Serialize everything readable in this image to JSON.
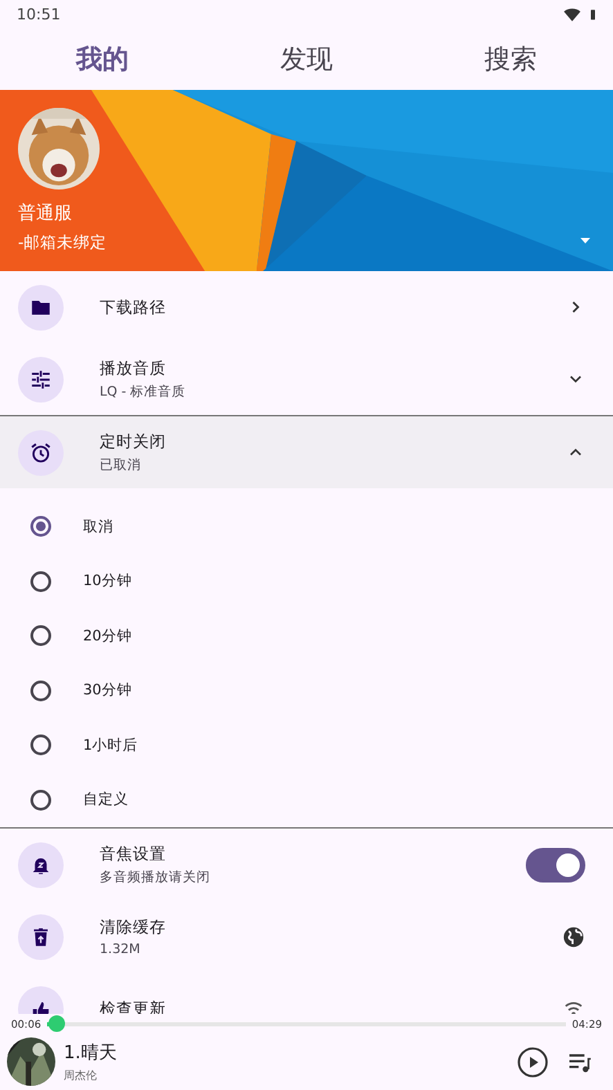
{
  "status_bar": {
    "time": "10:51"
  },
  "tabs": [
    {
      "label": "我的",
      "selected": true
    },
    {
      "label": "发现",
      "selected": false
    },
    {
      "label": "搜索",
      "selected": false
    }
  ],
  "profile": {
    "name": "普通服",
    "email": "-邮箱未绑定"
  },
  "settings": [
    {
      "kind": "link",
      "title": "下载路径"
    },
    {
      "kind": "expand",
      "title": "播放音质",
      "subtitle": "LQ - 标准音质",
      "expanded": false
    },
    {
      "kind": "expand",
      "title": "定时关闭",
      "subtitle": "已取消",
      "expanded": true,
      "options": [
        {
          "label": "取消",
          "selected": true
        },
        {
          "label": "10分钟",
          "selected": false
        },
        {
          "label": "20分钟",
          "selected": false
        },
        {
          "label": "30分钟",
          "selected": false
        },
        {
          "label": "1小时后",
          "selected": false
        },
        {
          "label": "自定义",
          "selected": false
        }
      ]
    },
    {
      "kind": "switch",
      "title": "音焦设置",
      "subtitle": "多音频播放请关闭",
      "on": true
    },
    {
      "kind": "action",
      "title": "清除缓存",
      "subtitle": "1.32M"
    },
    {
      "kind": "action",
      "title": "检查更新"
    }
  ],
  "player": {
    "elapsed": "00:06",
    "total": "04:29",
    "level": 0.02,
    "title": "1.晴天",
    "artist": "周杰伦"
  }
}
